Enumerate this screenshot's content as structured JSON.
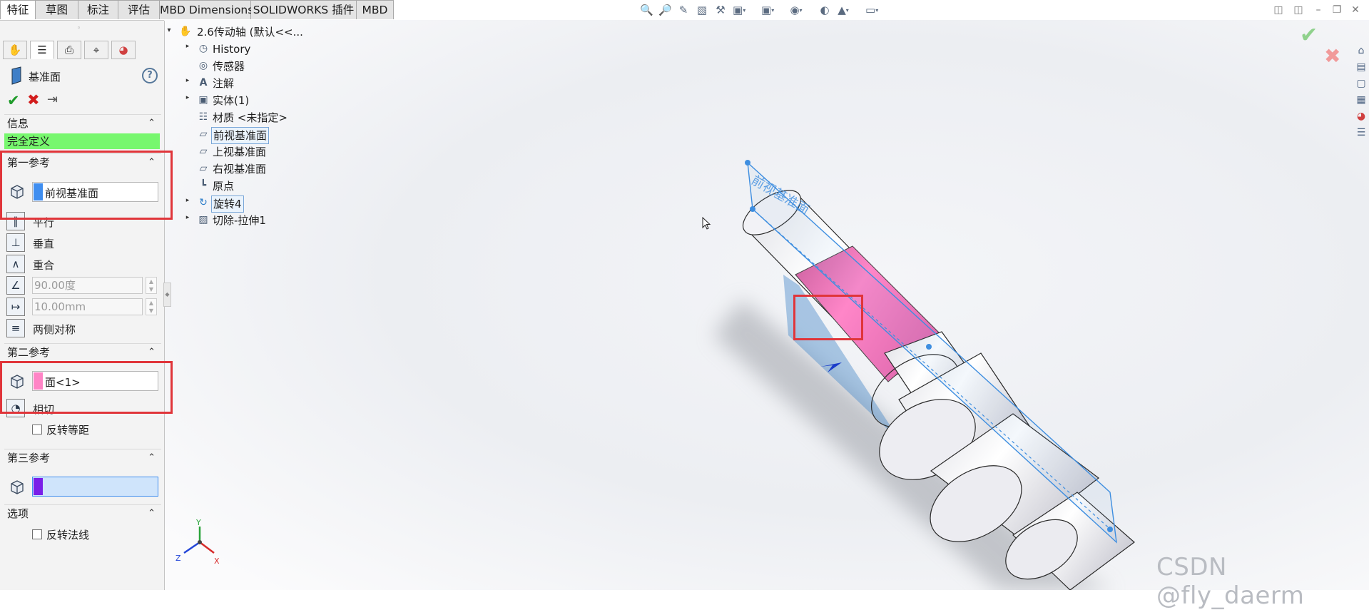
{
  "tabs": [
    "特征",
    "草图",
    "标注",
    "评估",
    "MBD Dimensions",
    "SOLIDWORKS 插件",
    "MBD"
  ],
  "view_toolbar_icons": [
    "zoom-to-fit-icon",
    "zoom-area-icon",
    "previous-view-icon",
    "section-view-icon",
    "view-settings-icon",
    "display-style-icon",
    "view-orientation-icon",
    "hide-show-icon",
    "edit-appearance-icon",
    "apply-scene-icon",
    "monitor-icon"
  ],
  "left_panel": {
    "panel_tabs": [
      "feature-manager-tab",
      "property-manager-tab",
      "configuration-manager-tab",
      "dimxpert-tab",
      "display-manager-tab"
    ],
    "title": "基准面",
    "help": "?",
    "sections": {
      "info": {
        "title": "信息",
        "status": "完全定义"
      },
      "first_ref": {
        "title": "第一参考",
        "value": "前视基准面",
        "swatch_color": "#3f8ef0",
        "options": [
          "平行",
          "垂直",
          "重合"
        ],
        "angle": "90.00度",
        "distance": "10.00mm",
        "symmetric": "两侧对称"
      },
      "second_ref": {
        "title": "第二参考",
        "value": "面<1>",
        "swatch_color": "#ff84c6",
        "options": [
          "相切"
        ],
        "flip_offset": "反转等距"
      },
      "third_ref": {
        "title": "第三参考",
        "value": "",
        "swatch_color": "#7a1fe8"
      },
      "options_sec": {
        "title": "选项",
        "flip_normal": "反转法线"
      }
    }
  },
  "tree": {
    "root": "2.6传动轴 (默认<<...",
    "items": [
      {
        "label": "History",
        "icon": "history-icon",
        "expandable": true
      },
      {
        "label": "传感器",
        "icon": "sensor-icon",
        "expandable": false
      },
      {
        "label": "注解",
        "icon": "annotation-icon",
        "expandable": true
      },
      {
        "label": "实体(1)",
        "icon": "solid-bodies-icon",
        "expandable": true
      },
      {
        "label": "材质 <未指定>",
        "icon": "material-icon",
        "expandable": false
      },
      {
        "label": "前视基准面",
        "icon": "plane-icon",
        "expandable": false,
        "selected": true
      },
      {
        "label": "上视基准面",
        "icon": "plane-icon",
        "expandable": false
      },
      {
        "label": "右视基准面",
        "icon": "plane-icon",
        "expandable": false
      },
      {
        "label": "原点",
        "icon": "origin-icon",
        "expandable": false
      },
      {
        "label": "旋转4",
        "icon": "revolve-icon",
        "expandable": true,
        "selected": true
      },
      {
        "label": "切除-拉伸1",
        "icon": "cut-extrude-icon",
        "expandable": true
      }
    ]
  },
  "viewport": {
    "plane_preview_label": "前视基准面",
    "axis_labels": [
      "X",
      "Y",
      "Z"
    ],
    "confirm": "✔",
    "cancel": "✖"
  },
  "side_toolbar": [
    "home-icon",
    "3d-content-icon",
    "file-explorer-icon",
    "view-palette-icon",
    "appearances-icon",
    "custom-properties-icon"
  ],
  "watermark": "CSDN @fly_daerm"
}
